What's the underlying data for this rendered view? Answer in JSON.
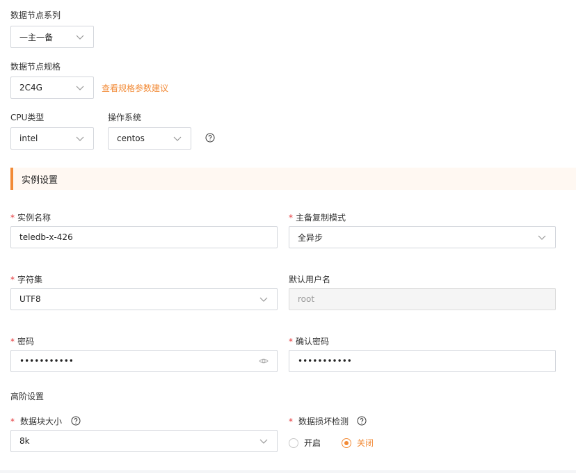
{
  "data_node_series": {
    "label": "数据节点系列",
    "value": "一主一备"
  },
  "data_node_spec": {
    "label": "数据节点规格",
    "value": "2C4G",
    "link": "查看规格参数建议"
  },
  "cpu_type": {
    "label": "CPU类型",
    "value": "intel"
  },
  "os": {
    "label": "操作系统",
    "value": "centos"
  },
  "section": {
    "title": "实例设置"
  },
  "instance_name": {
    "label": "实例名称",
    "value": "teledb-x-426"
  },
  "replication_mode": {
    "label": "主备复制模式",
    "value": "全异步"
  },
  "charset": {
    "label": "字符集",
    "value": "UTF8"
  },
  "default_user": {
    "label": "默认用户名",
    "value": "root"
  },
  "password": {
    "label": "密码",
    "value": "•••••••••••"
  },
  "confirm_password": {
    "label": "确认密码",
    "value": "•••••••••••"
  },
  "advanced": {
    "title": "高阶设置"
  },
  "block_size": {
    "label": "数据块大小",
    "value": "8k"
  },
  "corruption_check": {
    "label": "数据损坏检测",
    "options": [
      "开启",
      "关闭"
    ],
    "selected": "关闭"
  },
  "required_mark": "*",
  "colors": {
    "accent": "#f28a36",
    "required": "#e4393c",
    "border": "#d3d6dc"
  }
}
